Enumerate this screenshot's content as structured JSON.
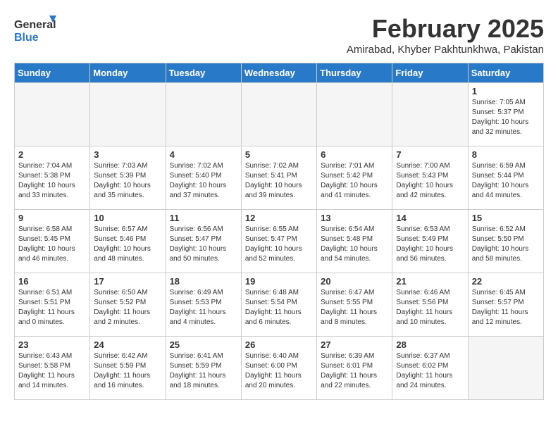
{
  "header": {
    "logo_line1": "General",
    "logo_line2": "Blue",
    "month": "February 2025",
    "location": "Amirabad, Khyber Pakhtunkhwa, Pakistan"
  },
  "weekdays": [
    "Sunday",
    "Monday",
    "Tuesday",
    "Wednesday",
    "Thursday",
    "Friday",
    "Saturday"
  ],
  "weeks": [
    [
      {
        "day": "",
        "info": ""
      },
      {
        "day": "",
        "info": ""
      },
      {
        "day": "",
        "info": ""
      },
      {
        "day": "",
        "info": ""
      },
      {
        "day": "",
        "info": ""
      },
      {
        "day": "",
        "info": ""
      },
      {
        "day": "1",
        "info": "Sunrise: 7:05 AM\nSunset: 5:37 PM\nDaylight: 10 hours and 32 minutes."
      }
    ],
    [
      {
        "day": "2",
        "info": "Sunrise: 7:04 AM\nSunset: 5:38 PM\nDaylight: 10 hours and 33 minutes."
      },
      {
        "day": "3",
        "info": "Sunrise: 7:03 AM\nSunset: 5:39 PM\nDaylight: 10 hours and 35 minutes."
      },
      {
        "day": "4",
        "info": "Sunrise: 7:02 AM\nSunset: 5:40 PM\nDaylight: 10 hours and 37 minutes."
      },
      {
        "day": "5",
        "info": "Sunrise: 7:02 AM\nSunset: 5:41 PM\nDaylight: 10 hours and 39 minutes."
      },
      {
        "day": "6",
        "info": "Sunrise: 7:01 AM\nSunset: 5:42 PM\nDaylight: 10 hours and 41 minutes."
      },
      {
        "day": "7",
        "info": "Sunrise: 7:00 AM\nSunset: 5:43 PM\nDaylight: 10 hours and 42 minutes."
      },
      {
        "day": "8",
        "info": "Sunrise: 6:59 AM\nSunset: 5:44 PM\nDaylight: 10 hours and 44 minutes."
      }
    ],
    [
      {
        "day": "9",
        "info": "Sunrise: 6:58 AM\nSunset: 5:45 PM\nDaylight: 10 hours and 46 minutes."
      },
      {
        "day": "10",
        "info": "Sunrise: 6:57 AM\nSunset: 5:46 PM\nDaylight: 10 hours and 48 minutes."
      },
      {
        "day": "11",
        "info": "Sunrise: 6:56 AM\nSunset: 5:47 PM\nDaylight: 10 hours and 50 minutes."
      },
      {
        "day": "12",
        "info": "Sunrise: 6:55 AM\nSunset: 5:47 PM\nDaylight: 10 hours and 52 minutes."
      },
      {
        "day": "13",
        "info": "Sunrise: 6:54 AM\nSunset: 5:48 PM\nDaylight: 10 hours and 54 minutes."
      },
      {
        "day": "14",
        "info": "Sunrise: 6:53 AM\nSunset: 5:49 PM\nDaylight: 10 hours and 56 minutes."
      },
      {
        "day": "15",
        "info": "Sunrise: 6:52 AM\nSunset: 5:50 PM\nDaylight: 10 hours and 58 minutes."
      }
    ],
    [
      {
        "day": "16",
        "info": "Sunrise: 6:51 AM\nSunset: 5:51 PM\nDaylight: 11 hours and 0 minutes."
      },
      {
        "day": "17",
        "info": "Sunrise: 6:50 AM\nSunset: 5:52 PM\nDaylight: 11 hours and 2 minutes."
      },
      {
        "day": "18",
        "info": "Sunrise: 6:49 AM\nSunset: 5:53 PM\nDaylight: 11 hours and 4 minutes."
      },
      {
        "day": "19",
        "info": "Sunrise: 6:48 AM\nSunset: 5:54 PM\nDaylight: 11 hours and 6 minutes."
      },
      {
        "day": "20",
        "info": "Sunrise: 6:47 AM\nSunset: 5:55 PM\nDaylight: 11 hours and 8 minutes."
      },
      {
        "day": "21",
        "info": "Sunrise: 6:46 AM\nSunset: 5:56 PM\nDaylight: 11 hours and 10 minutes."
      },
      {
        "day": "22",
        "info": "Sunrise: 6:45 AM\nSunset: 5:57 PM\nDaylight: 11 hours and 12 minutes."
      }
    ],
    [
      {
        "day": "23",
        "info": "Sunrise: 6:43 AM\nSunset: 5:58 PM\nDaylight: 11 hours and 14 minutes."
      },
      {
        "day": "24",
        "info": "Sunrise: 6:42 AM\nSunset: 5:59 PM\nDaylight: 11 hours and 16 minutes."
      },
      {
        "day": "25",
        "info": "Sunrise: 6:41 AM\nSunset: 5:59 PM\nDaylight: 11 hours and 18 minutes."
      },
      {
        "day": "26",
        "info": "Sunrise: 6:40 AM\nSunset: 6:00 PM\nDaylight: 11 hours and 20 minutes."
      },
      {
        "day": "27",
        "info": "Sunrise: 6:39 AM\nSunset: 6:01 PM\nDaylight: 11 hours and 22 minutes."
      },
      {
        "day": "28",
        "info": "Sunrise: 6:37 AM\nSunset: 6:02 PM\nDaylight: 11 hours and 24 minutes."
      },
      {
        "day": "",
        "info": ""
      }
    ]
  ]
}
